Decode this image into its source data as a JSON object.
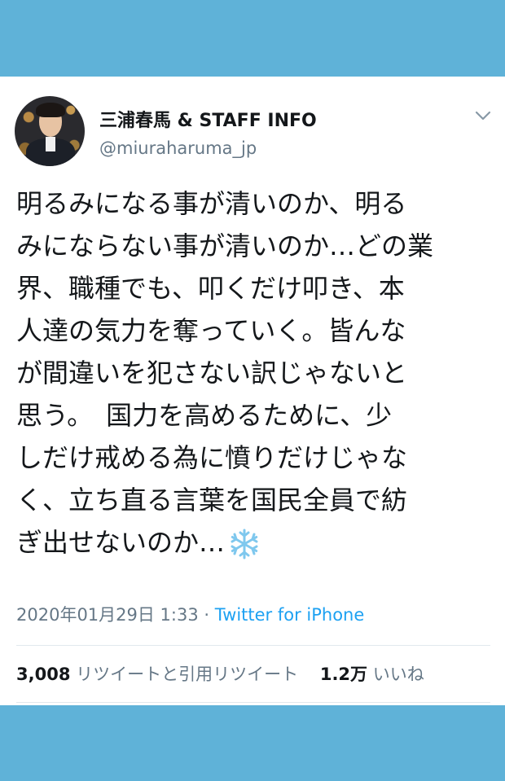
{
  "tweet": {
    "display_name": "三浦春馬 & STAFF INFO",
    "handle": "@miuraharuma_jp",
    "text_lines": [
      "明るみになる事が清いのか、明る",
      "みにならない事が清いのか…どの業",
      "界、職種でも、叩くだけ叩き、本",
      "人達の気力を奪っていく。皆んな",
      "が間違いを犯さない訳じゃないと",
      "思う。　国力を高めるために、少",
      "しだけ戒める為に憤りだけじゃな",
      "く、立ち直る言葉を国民全員で紡",
      "ぎ出せないのか…"
    ],
    "emoji_icon": "snowflake-icon",
    "timestamp": "2020年01月29日 1:33",
    "separator": "·",
    "source": "Twitter for iPhone",
    "retweets_count": "3,008",
    "retweets_label": "リツイートと引用リツイート",
    "likes_count": "1.2万",
    "likes_label": "いいね"
  },
  "colors": {
    "band": "#5fb2d8",
    "link": "#1da1f2",
    "secondary_text": "#657786",
    "primary_text": "#14171a"
  }
}
